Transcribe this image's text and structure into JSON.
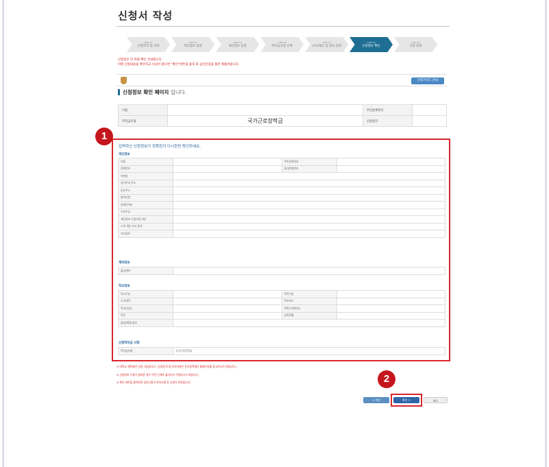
{
  "page_title": "신청서 작성",
  "steps": [
    {
      "num": "STEP 01",
      "label": "신청자격 및 서약"
    },
    {
      "num": "STEP 02",
      "label": "학교정보 입력"
    },
    {
      "num": "STEP 03",
      "label": "개인정보 입력"
    },
    {
      "num": "STEP 04",
      "label": "학자금유형 선택"
    },
    {
      "num": "STEP 05",
      "label": "소득/재산 및 정보 입력"
    },
    {
      "num": "STEP 06",
      "label": "신청정보 확인"
    },
    {
      "num": "STEP 07",
      "label": "신청 완료"
    }
  ],
  "notice_lines": [
    "신청정보 한 표를 확인 안내합니다.",
    "아래 신청내용을 확인하고 이상이 없으면 \"확인\"버튼을 클릭 후 공인인증을 통한 제출바랍니다."
  ],
  "banner_button": "신청가이드 안내",
  "section_title": "신청정보 확인 페이지",
  "section_title_suffix": "입니다.",
  "info": {
    "name_label": "이름",
    "name_value": "",
    "rrn_label": "주민등록번호",
    "rrn_value": "",
    "type_label": "학자금유형",
    "type_value": "국가근로장학금",
    "date_label": "신청일자",
    "date_value": ""
  },
  "callouts": {
    "one": "1",
    "two": "2"
  },
  "guide_text": "입력하신 신청정보가 정확한지 다시한번 확인하세요.",
  "personal": {
    "heading": "개인정보",
    "rows": [
      {
        "label": "이름",
        "label2": "주민등록번호"
      },
      {
        "label": "전화번호",
        "label2": "휴대전화번호"
      },
      {
        "label": "이메일",
        "label2": ""
      },
      {
        "label": "실거주지 주소",
        "label2": ""
      },
      {
        "label": "등본주소",
        "label2": ""
      },
      {
        "label": "병역사항",
        "label2": ""
      },
      {
        "label": "장애인여부",
        "label2": ""
      },
      {
        "label": "기초수급",
        "label2": ""
      },
      {
        "label": "개인정보 수집이용 여부",
        "label2": ""
      },
      {
        "label": "소득 재산 조사 동의",
        "label2": ""
      },
      {
        "label": "기타정보",
        "label2": ""
      }
    ]
  },
  "account": {
    "heading": "계좌정보",
    "rows": [
      {
        "label": "출금계좌"
      }
    ]
  },
  "school": {
    "heading": "학교정보",
    "rows": [
      {
        "label": "학교구분",
        "label2": "학적구분"
      },
      {
        "label": "소속대학",
        "label2": "학교코드"
      },
      {
        "label": "학과(전공)",
        "label2": "학번(수험번호)"
      },
      {
        "label": "학년",
        "label2": "입학연월"
      },
      {
        "label": "졸업(예정)일자",
        "label2": ""
      }
    ]
  },
  "extra": {
    "heading": "신청학자금 사항",
    "rows": [
      {
        "label": "학자금유형",
        "value": "국가근로장학금"
      }
    ]
  },
  "notes": [
    "※ 대학교 재학생만 신청 가능합니다. (신청자격 및 유의사항은 한국장학재단 홈페이지를 참고하시기 바랍니다.)",
    "※ 신청정보 수정이 필요한 경우 이전 단계로 돌아가서 수정하시기 바랍니다.",
    "※ 확인 버튼을 클릭하면 공인인증서 전자서명 후 신청이 완료됩니다."
  ],
  "buttons": {
    "prev": "< 이전",
    "confirm": "확인 >",
    "cancel": "취소"
  }
}
